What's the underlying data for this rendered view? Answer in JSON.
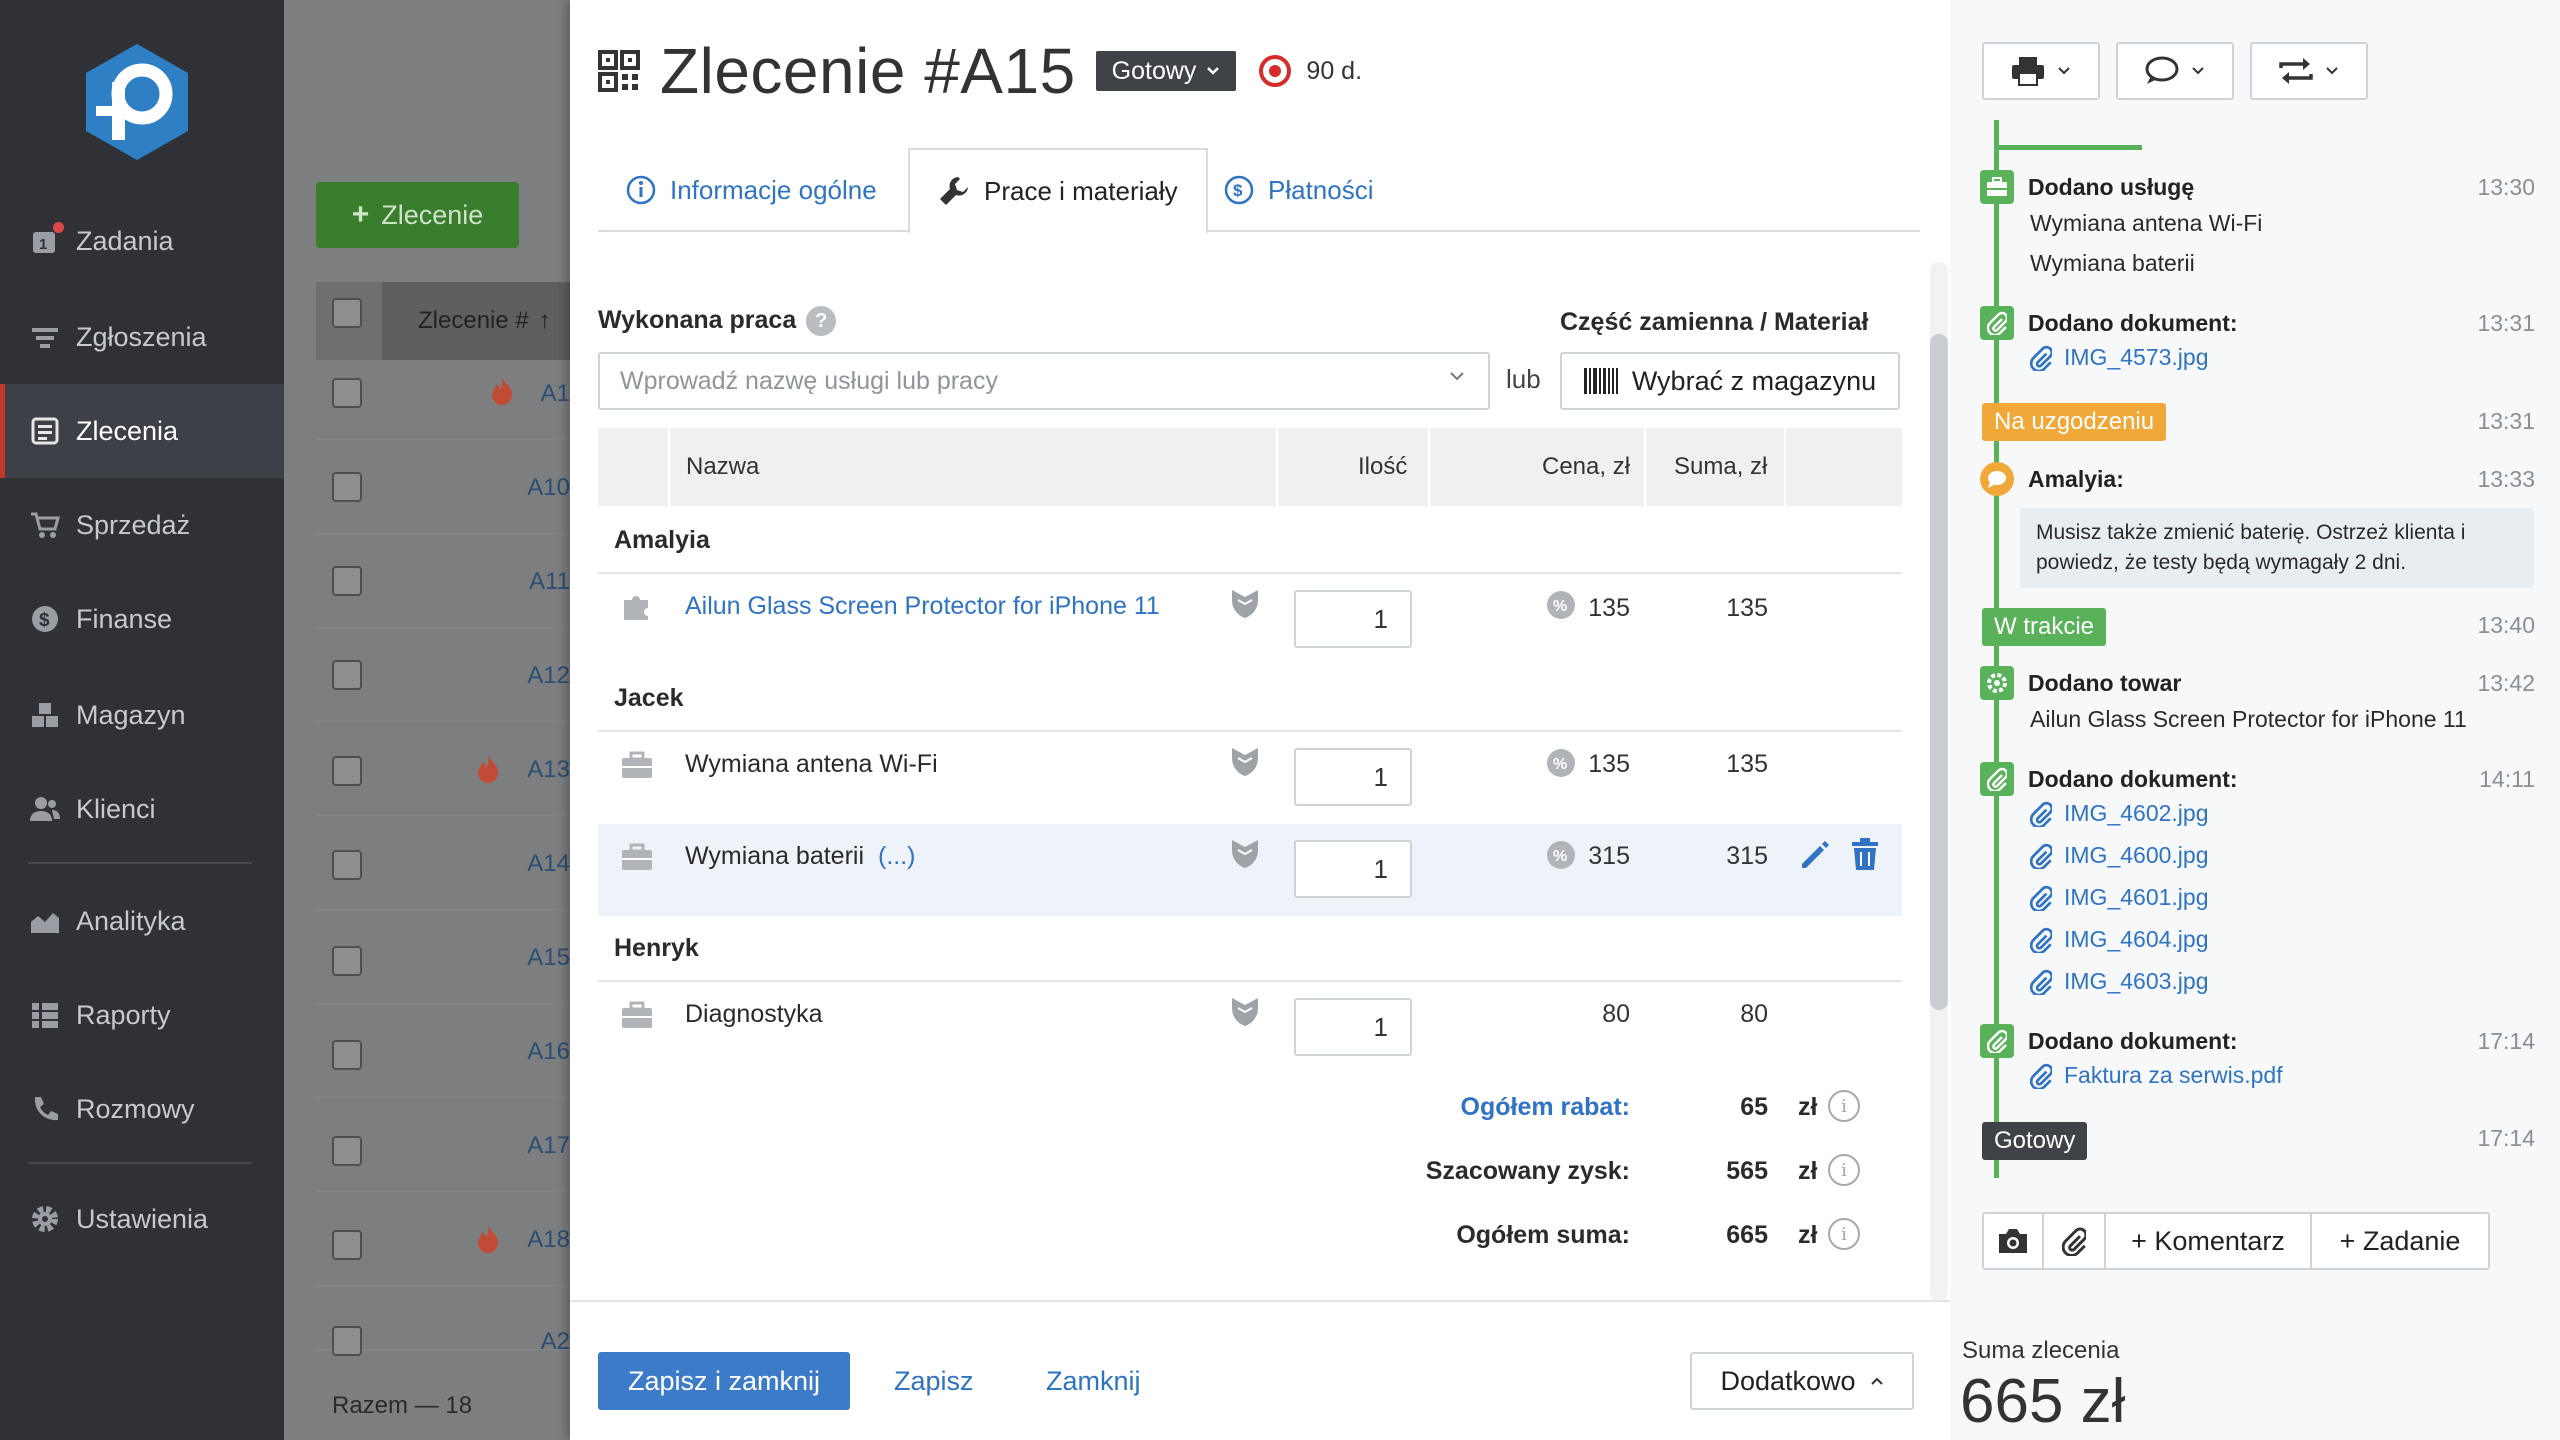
{
  "sidebar": {
    "items": [
      {
        "label": "Zadania",
        "icon": "tasks-icon"
      },
      {
        "label": "Zgłoszenia",
        "icon": "filter-icon"
      },
      {
        "label": "Zlecenia",
        "icon": "orders-icon",
        "active": true
      },
      {
        "label": "Sprzedaż",
        "icon": "cart-icon"
      },
      {
        "label": "Finanse",
        "icon": "dollar-icon"
      },
      {
        "label": "Magazyn",
        "icon": "boxes-icon"
      },
      {
        "label": "Klienci",
        "icon": "users-icon"
      },
      {
        "label": "Analityka",
        "icon": "area-chart-icon"
      },
      {
        "label": "Raporty",
        "icon": "list-icon"
      },
      {
        "label": "Rozmowy",
        "icon": "phone-icon"
      },
      {
        "label": "Ustawienia",
        "icon": "gear-icon"
      }
    ],
    "tasks_badge": "1"
  },
  "background_list": {
    "add_button": "Zlecenie",
    "column_header": "Zlecenie #",
    "rows": [
      "A1",
      "A10",
      "A11",
      "A12",
      "A13",
      "A14",
      "A15",
      "A16",
      "A17",
      "A18",
      "A2"
    ],
    "footer": "Razem — 18"
  },
  "modal": {
    "title": "Zlecenie #A15",
    "status": "Gotowy",
    "days": "90 d.",
    "tabs": [
      {
        "label": "Informacje ogólne",
        "icon": "info-icon"
      },
      {
        "label": "Prace i materiały",
        "icon": "wrench-icon",
        "active": true
      },
      {
        "label": "Płatności",
        "icon": "dollar-circle-icon"
      }
    ],
    "work_label": "Wykonana praca",
    "part_label": "Część zamienna / Materiał",
    "service_placeholder": "Wprowadź nazwę usługi lub pracy",
    "or_label": "lub",
    "store_button": "Wybrać z magazynu",
    "columns": {
      "name": "Nazwa",
      "qty": "Ilość",
      "price": "Cena, zł",
      "sum": "Suma, zł"
    },
    "groups": [
      {
        "name": "Amalyia",
        "items": [
          {
            "name": "Ailun Glass Screen Protector for iPhone 11",
            "qty": "1",
            "price": "135",
            "sum": "135",
            "kind": "product"
          }
        ]
      },
      {
        "name": "Jacek",
        "items": [
          {
            "name": "Wymiana antena Wi-Fi",
            "qty": "1",
            "price": "135",
            "sum": "135",
            "kind": "service"
          },
          {
            "name": "Wymiana baterii",
            "more": "(...)",
            "qty": "1",
            "price": "315",
            "sum": "315",
            "kind": "service"
          }
        ]
      },
      {
        "name": "Henryk",
        "items": [
          {
            "name": "Diagnostyka",
            "qty": "1",
            "price": "80",
            "sum": "80",
            "kind": "service"
          }
        ]
      }
    ],
    "totals": [
      {
        "label": "Ogółem rabat:",
        "value": "65",
        "currency": "zł"
      },
      {
        "label": "Szacowany zysk:",
        "value": "565",
        "currency": "zł"
      },
      {
        "label": "Ogółem suma:",
        "value": "665",
        "currency": "zł"
      }
    ],
    "footer": {
      "save_close": "Zapisz i zamknij",
      "save": "Zapisz",
      "close": "Zamknij",
      "more": "Dodatkowo"
    }
  },
  "timeline": {
    "entries": [
      {
        "title": "Dodano usługę",
        "time": "13:30",
        "lines": [
          "Wymiana antena Wi-Fi",
          "Wymiana baterii"
        ]
      },
      {
        "title": "Dodano dokument:",
        "time": "13:31",
        "files": [
          "IMG_4573.jpg"
        ]
      },
      {
        "badge": "Na uzgodzeniu",
        "time": "13:31"
      },
      {
        "title": "Amalyia:",
        "time": "13:33",
        "comment": "Musisz także zmienić baterię. Ostrzeż klienta i powiedz, że testy będą wymagały 2 dni."
      },
      {
        "badge": "W trakcie",
        "time": "13:40"
      },
      {
        "title": "Dodano towar",
        "time": "13:42",
        "lines": [
          "Ailun Glass Screen Protector for iPhone 11"
        ]
      },
      {
        "title": "Dodano dokument:",
        "time": "14:11",
        "files": [
          "IMG_4602.jpg",
          "IMG_4600.jpg",
          "IMG_4601.jpg",
          "IMG_4604.jpg",
          "IMG_4603.jpg"
        ]
      },
      {
        "title": "Dodano dokument:",
        "time": "17:14",
        "files": [
          "Faktura za serwis.pdf"
        ]
      },
      {
        "badge": "Gotowy",
        "time": "17:14"
      }
    ],
    "comment_button": "+ Komentarz",
    "task_button": "+ Zadanie"
  },
  "order_sum": {
    "label": "Suma zlecenia",
    "value": "665 zł"
  },
  "colors": {
    "accent": "#2f73c2",
    "success": "#59b25a",
    "warning": "#f0a938",
    "primary_btn": "#3c7bc8",
    "sidebar": "#2f3136"
  }
}
